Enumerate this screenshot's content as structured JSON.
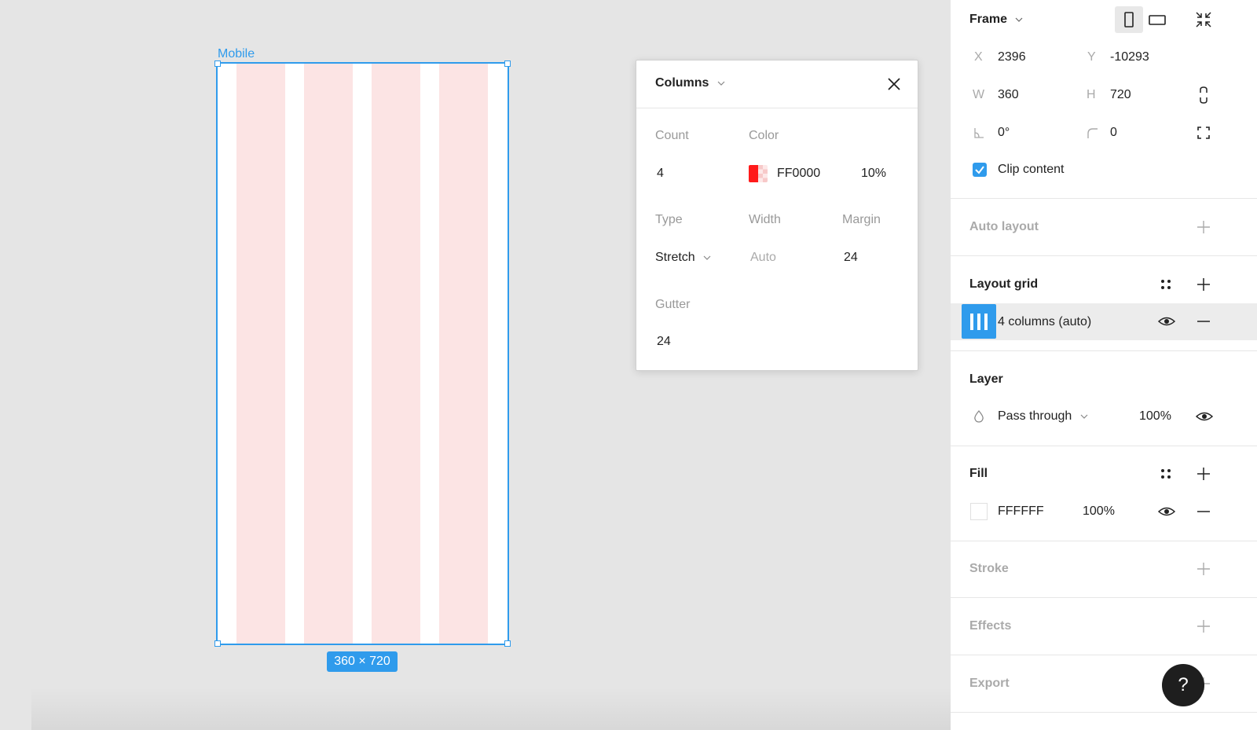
{
  "canvas": {
    "frame_label": "Mobile",
    "size_badge": "360 × 720",
    "column_color": "#fce4e4",
    "selection_color": "#2f9bec"
  },
  "columns_popup": {
    "title": "Columns",
    "count_label": "Count",
    "count_value": "4",
    "color_label": "Color",
    "color_hex": "FF0000",
    "color_opacity": "10%",
    "type_label": "Type",
    "type_value": "Stretch",
    "width_label": "Width",
    "width_value": "Auto",
    "margin_label": "Margin",
    "margin_value": "24",
    "gutter_label": "Gutter",
    "gutter_value": "24"
  },
  "panel": {
    "frame": {
      "title": "Frame",
      "x_label": "X",
      "x_value": "2396",
      "y_label": "Y",
      "y_value": "-10293",
      "w_label": "W",
      "w_value": "360",
      "h_label": "H",
      "h_value": "720",
      "rotation_value": "0°",
      "radius_value": "0",
      "clip_content_label": "Clip content",
      "clip_content_checked": true
    },
    "auto_layout": {
      "title": "Auto layout"
    },
    "layout_grid": {
      "title": "Layout grid",
      "item_label": "4 columns (auto)"
    },
    "layer": {
      "title": "Layer",
      "blend_mode": "Pass through",
      "opacity": "100%"
    },
    "fill": {
      "title": "Fill",
      "hex": "FFFFFF",
      "opacity": "100%"
    },
    "stroke": {
      "title": "Stroke"
    },
    "effects": {
      "title": "Effects"
    },
    "export": {
      "title": "Export"
    },
    "help_label": "?"
  },
  "icons": [
    "chevron-down-icon",
    "close-icon",
    "portrait-icon",
    "landscape-icon",
    "collapse-icon",
    "constrain-proportions-icon",
    "rotation-icon",
    "corner-radius-icon",
    "independent-corners-icon",
    "checkbox-checked-icon",
    "plus-icon",
    "grid-styles-icon",
    "columns-grid-icon",
    "eye-icon",
    "minus-icon",
    "blend-drop-icon"
  ]
}
